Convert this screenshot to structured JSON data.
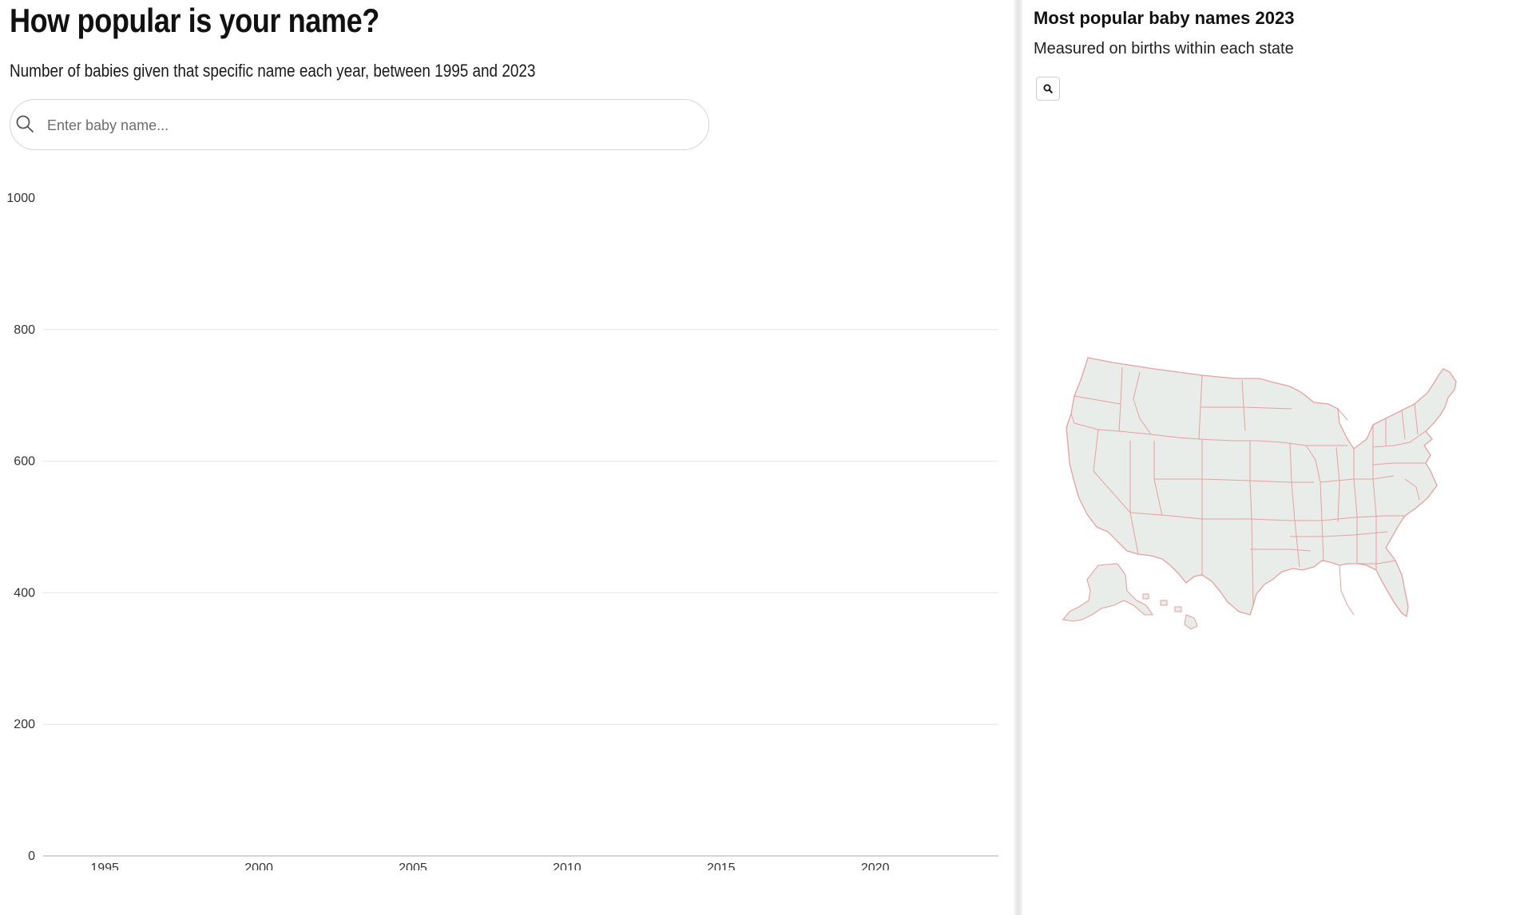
{
  "left": {
    "title": "How popular is your name?",
    "subtitle": "Number of babies given that specific name each year, between 1995 and 2023",
    "search": {
      "placeholder": "Enter baby name...",
      "value": "",
      "icon": "search-icon"
    }
  },
  "chart_data": {
    "type": "line",
    "title": "",
    "xlabel": "",
    "ylabel": "",
    "xlim": [
      1993,
      2024
    ],
    "ylim": [
      0,
      1000
    ],
    "x_ticks": [
      1995,
      2000,
      2005,
      2010,
      2015,
      2020
    ],
    "y_ticks": [
      0,
      200,
      400,
      600,
      800,
      1000
    ],
    "grid": true,
    "series": []
  },
  "right": {
    "title": "Most popular baby names 2023",
    "subtitle": "Measured on births within each state",
    "zoom_icon": "search-icon",
    "map": {
      "type": "US states choropleth",
      "fill": "#e9ede9",
      "stroke": "#e6a0a0"
    }
  },
  "colors": {
    "grid": "#e6e6e6",
    "axis": "#bdbdbd",
    "state_fill": "#e9ede9",
    "state_border": "#e6a0a0"
  }
}
